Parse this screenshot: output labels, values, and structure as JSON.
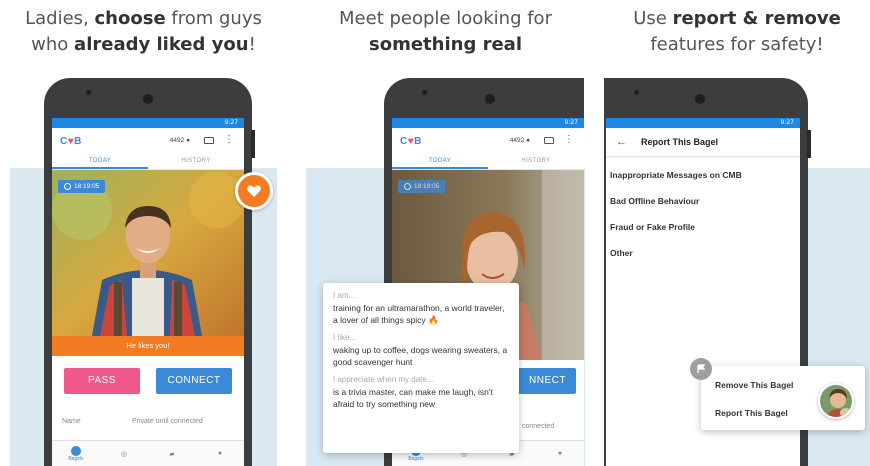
{
  "panel1": {
    "caption": {
      "pre": "Ladies, ",
      "bold1": "choose",
      "mid": " from guys",
      "line2_pre": "who ",
      "bold2": "already liked you",
      "end": "!"
    },
    "status_time": "9:27",
    "logo": {
      "c": "C",
      "heart": "♥",
      "b": "B"
    },
    "beans": "4492",
    "tabs": [
      "TODAY",
      "HISTORY"
    ],
    "timer": "18:19:05",
    "likes_text": "He likes you!",
    "pass_label": "PASS",
    "connect_label": "CONNECT",
    "name_label": "Name",
    "name_value": "Private until connected",
    "nav_label": "Bagels"
  },
  "panel2": {
    "caption": {
      "line1": "Meet people looking for",
      "bold": "something real"
    },
    "status_time": "9:27",
    "logo": {
      "c": "C",
      "heart": "♥",
      "b": "B"
    },
    "beans": "4492",
    "tabs": [
      "TODAY",
      "HISTORY"
    ],
    "timer": "18:19:05",
    "bio": [
      {
        "q": "I am...",
        "a": "training for an ultramarathon, a world traveler, a lover of all things spicy 🔥"
      },
      {
        "q": "I like...",
        "a": "waking up to coffee, dogs wearing sweaters, a good scavenger hunt"
      },
      {
        "q": "I appreciate when my date...",
        "a": "is a trivia master, can make me laugh, isn't afraid to try something new"
      }
    ],
    "connect_partial": "NNECT",
    "connected_partial": "connected",
    "nav_label": "Bagels"
  },
  "panel3": {
    "caption": {
      "pre": "Use ",
      "bold": "report & remove",
      "line2": "features for safety!"
    },
    "status_time": "9:27",
    "report_title": "Report This Bagel",
    "report_options": [
      "Inappropriate Messages on CMB",
      "Bad Offline Behaviour",
      "Fraud or Fake Profile",
      "Other"
    ],
    "menu": {
      "remove": "Remove This Bagel",
      "report": "Report This Bagel"
    }
  },
  "colors": {
    "accent_blue": "#3b8ad9",
    "pass_pink": "#f0578a",
    "orange": "#f37b22",
    "status_blue": "#1e88e5"
  }
}
